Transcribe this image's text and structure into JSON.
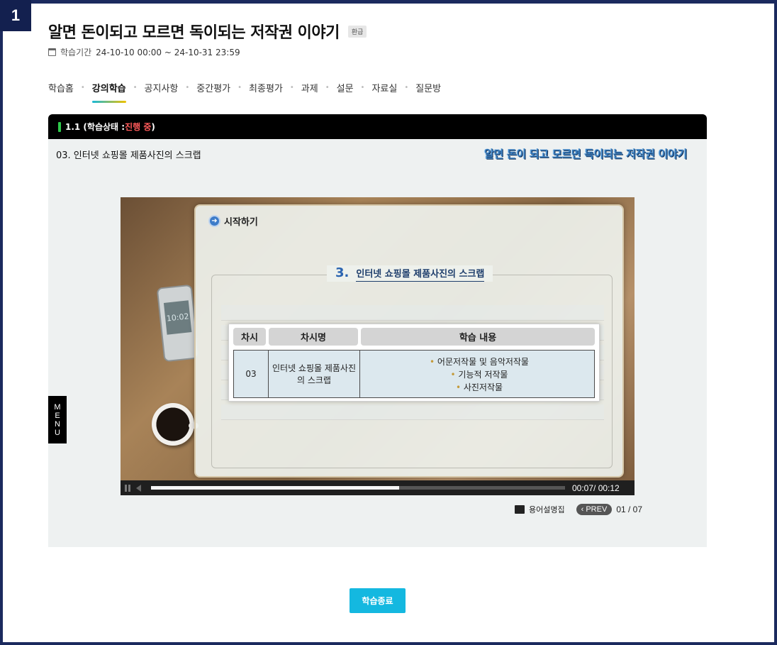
{
  "badge": "1",
  "course": {
    "title": "알면 돈이되고 모르면 독이되는 저작권 이야기",
    "refund_tag": "환급",
    "period_label": "학습기간",
    "period": "24-10-10 00:00 ~ 24-10-31 23:59"
  },
  "tabs": [
    {
      "label": "학습홈",
      "active": false
    },
    {
      "label": "강의학습",
      "active": true
    },
    {
      "label": "공지사항",
      "active": false
    },
    {
      "label": "중간평가",
      "active": false
    },
    {
      "label": "최종평가",
      "active": false
    },
    {
      "label": "과제",
      "active": false
    },
    {
      "label": "설문",
      "active": false
    },
    {
      "label": "자료실",
      "active": false
    },
    {
      "label": "질문방",
      "active": false
    }
  ],
  "panel": {
    "section": "1.1 (학습상태 : ",
    "status": "진행 중",
    "section_close": ")",
    "lesson_name": "03. 인터넷 쇼핑몰 제품사진의 스크랩",
    "brand_caption": "알면 돈이 되고 모르면 독이되는 저작권 이야기",
    "menu_letters": [
      "M",
      "E",
      "N",
      "U"
    ]
  },
  "slide": {
    "start_label": "시작하기",
    "number": "3.",
    "heading": "인터넷 쇼핑몰 제품사진의 스크랩",
    "phone_time": "10:02",
    "table_headers": [
      "차시",
      "차시명",
      "학습 내용"
    ],
    "row": {
      "num": "03",
      "name": "인터넷 쇼핑몰 제품사진의 스크랩",
      "items": [
        "어문저작물 및 음악저작물",
        "기능적 저작물",
        "사진저작물"
      ]
    }
  },
  "player": {
    "progress": 0.6,
    "time": "00:07/ 00:12"
  },
  "footer": {
    "glossary": "용어설명집",
    "prev": "PREV",
    "page": "01 / 07"
  },
  "end_button": "학습종료",
  "colors": {
    "frame": "#1b2a5e",
    "accent": "#14b8e0",
    "status_red": "#ff5a5a",
    "status_green": "#2ec94a"
  }
}
